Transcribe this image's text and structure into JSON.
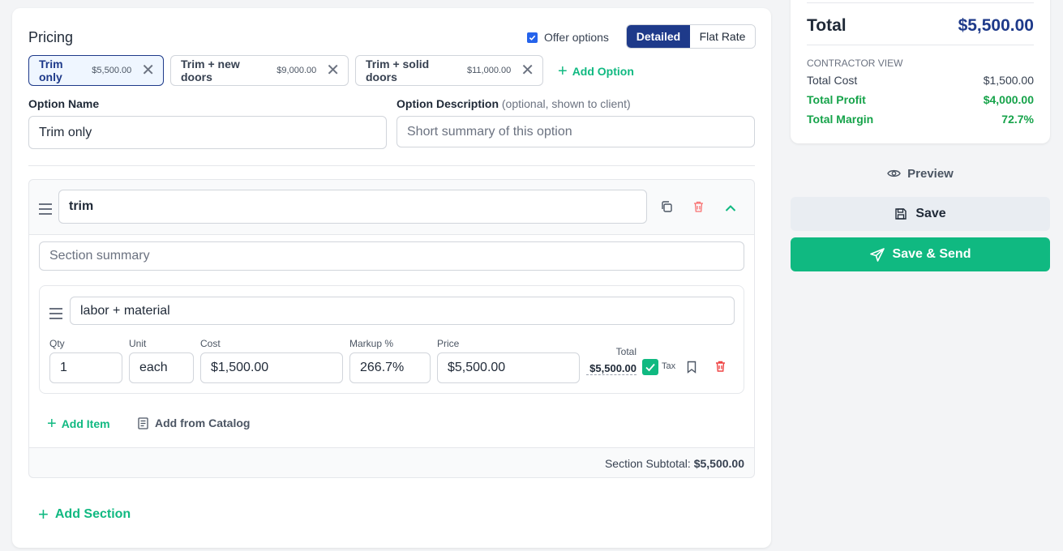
{
  "pricing": {
    "title": "Pricing",
    "offer_options_label": "Offer options",
    "offer_options_checked": true,
    "modes": [
      "Detailed",
      "Flat Rate"
    ],
    "active_mode": "Detailed"
  },
  "options": [
    {
      "name": "Trim only",
      "price": "$5,500.00",
      "selected": true
    },
    {
      "name": "Trim + new doors",
      "price": "$9,000.00",
      "selected": false
    },
    {
      "name": "Trim + solid doors",
      "price": "$11,000.00",
      "selected": false
    }
  ],
  "add_option_label": "Add Option",
  "option_form": {
    "name_label": "Option Name",
    "name_value": "Trim only",
    "desc_label": "Option Description",
    "desc_hint": "(optional, shown to client)",
    "desc_placeholder": "Short summary of this option"
  },
  "section": {
    "name": "trim",
    "summary_placeholder": "Section summary",
    "item": {
      "name": "labor + material",
      "qty_label": "Qty",
      "qty": "1",
      "unit_label": "Unit",
      "unit": "each",
      "cost_label": "Cost",
      "cost": "$1,500.00",
      "markup_label": "Markup %",
      "markup": "266.7%",
      "price_label": "Price",
      "price": "$5,500.00",
      "total_label": "Total",
      "total": "$5,500.00",
      "tax_label": "Tax",
      "tax_checked": true
    },
    "add_item_label": "Add Item",
    "add_catalog_label": "Add from Catalog",
    "subtotal_label": "Section Subtotal:",
    "subtotal_value": "$5,500.00"
  },
  "add_section_label": "Add Section",
  "summary": {
    "total_label": "Total",
    "total_value": "$5,500.00",
    "contractor_view_label": "CONTRACTOR VIEW",
    "total_cost_label": "Total Cost",
    "total_cost_value": "$1,500.00",
    "total_profit_label": "Total Profit",
    "total_profit_value": "$4,000.00",
    "total_margin_label": "Total Margin",
    "total_margin_value": "72.7%"
  },
  "actions": {
    "preview_label": "Preview",
    "save_label": "Save",
    "save_send_label": "Save & Send"
  },
  "colors": {
    "primary": "#1e3a8a",
    "accent_green": "#10b981",
    "profit_green": "#16a34a",
    "danger": "#ef4444"
  }
}
